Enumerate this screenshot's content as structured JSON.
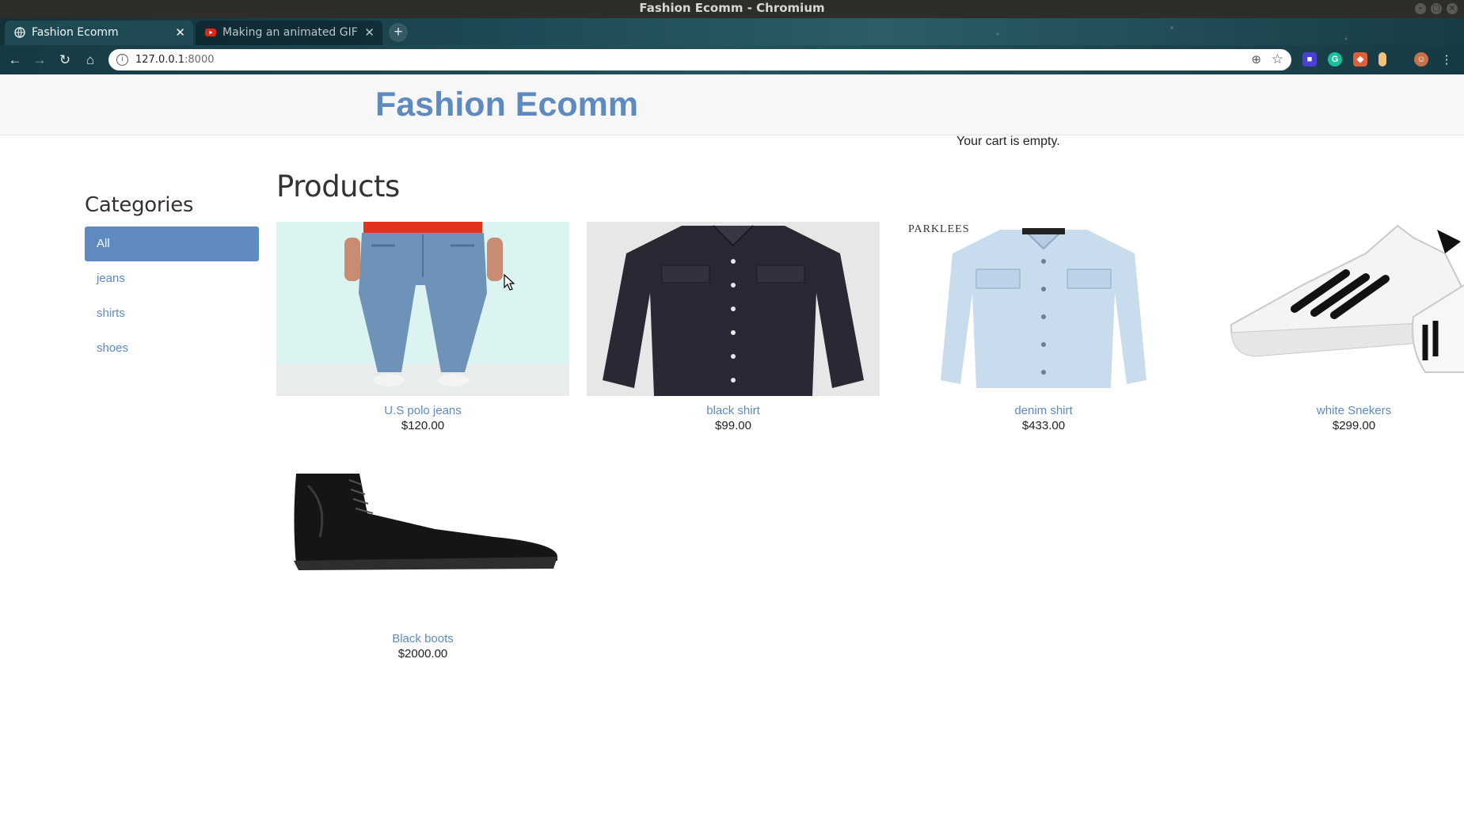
{
  "window": {
    "title": "Fashion Ecomm - Chromium"
  },
  "tabs": [
    {
      "label": "Fashion Ecomm",
      "active": true
    },
    {
      "label": "Making an animated GIF",
      "active": false
    }
  ],
  "address_bar": {
    "host": "127.0.0.1",
    "port": ":8000"
  },
  "site": {
    "title": "Fashion Ecomm",
    "cart_status": "Your cart is empty."
  },
  "sidebar": {
    "heading": "Categories",
    "items": [
      {
        "label": "All",
        "selected": true
      },
      {
        "label": "jeans",
        "selected": false
      },
      {
        "label": "shirts",
        "selected": false
      },
      {
        "label": "shoes",
        "selected": false
      }
    ]
  },
  "main": {
    "heading": "Products",
    "products": [
      {
        "name": "U.S polo jeans",
        "price": "$120.00",
        "image": "jeans-image"
      },
      {
        "name": "black shirt",
        "price": "$99.00",
        "image": "black-shirt-image"
      },
      {
        "name": "denim shirt",
        "price": "$433.00",
        "image": "denim-shirt-image",
        "image_text": "PARKLEES"
      },
      {
        "name": "white Snekers",
        "price": "$299.00",
        "image": "sneakers-image"
      },
      {
        "name": "Black boots",
        "price": "$2000.00",
        "image": "boots-image"
      }
    ]
  },
  "colors": {
    "accent": "#5e8ac0",
    "header_bg": "#f7f7f7",
    "chrome_dark": "#2f2d2a"
  }
}
